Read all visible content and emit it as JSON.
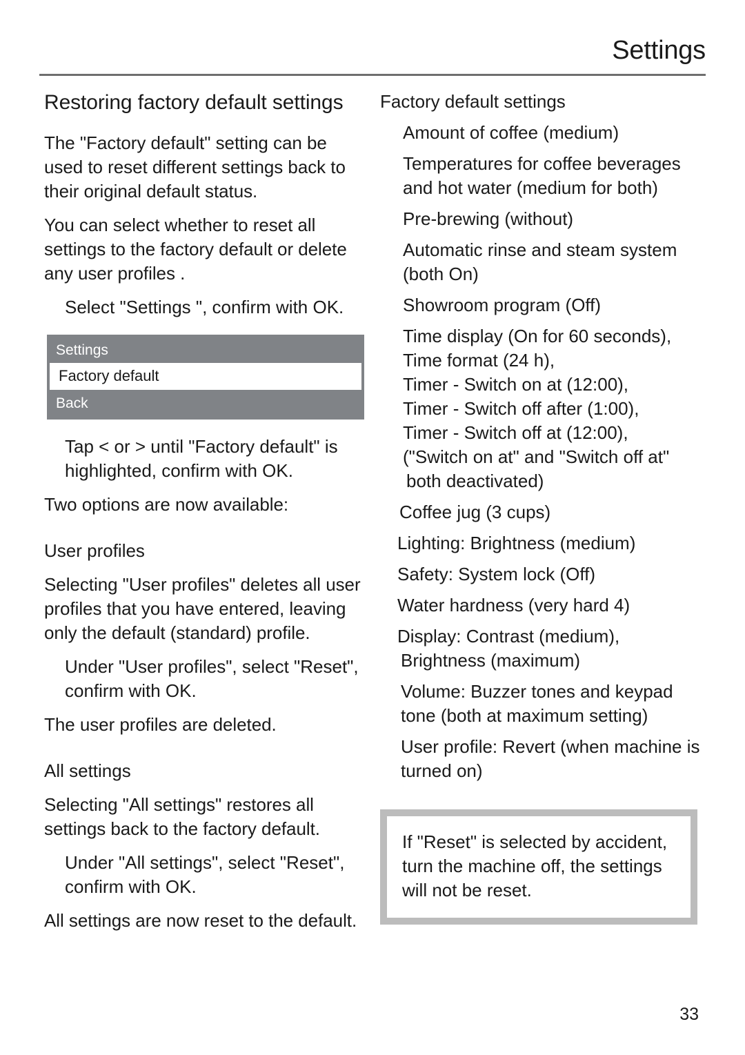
{
  "header": {
    "title": "Settings"
  },
  "left_column": {
    "section_title": "Restoring factory default settings",
    "intro_paragraph_1": "The \"Factory default\" setting can be used to reset different settings back to their original default status.",
    "intro_paragraph_2": "You can select whether to reset all settings  to the factory default or delete any user profiles  .",
    "step_select_settings": "Select \"Settings   \", confirm with OK.",
    "display": {
      "title": "Settings",
      "selected_item": "Factory  default",
      "back_item": "Back"
    },
    "step_tap": "Tap < or > until \"Factory default\" is highlighted, confirm with OK.",
    "two_options_line": "Two options are now available:",
    "user_profiles": {
      "heading": "User profiles",
      "body": "Selecting \"User profiles\" deletes all user profiles that you have entered, leaving only the default (standard) profile.",
      "step": "Under \"User profiles\", select \"Reset\", confirm with OK.",
      "result": "The user profiles are deleted."
    },
    "all_settings": {
      "heading": "All settings",
      "body": "Selecting \"All settings\" restores all settings back to the factory default.",
      "step": "Under \"All settings\", select \"Reset\", confirm with OK.",
      "result": "All settings are now reset to the default."
    }
  },
  "right_column": {
    "list_heading": "Factory default settings",
    "items": [
      "Amount of coffee (medium)",
      "Temperatures for coffee beverages and hot water (medium for both)",
      "Pre-brewing (without)",
      "Automatic rinse and steam system (both On)",
      "Showroom program (Off)",
      "Time display (On for 60 seconds), Time format (24 h), Timer - Switch on at (12:00), Timer - Switch off after (1:00), Timer - Switch off at (12:00), (\"Switch on at\" and \"Switch off at\" both deactivated)",
      "Coffee jug (3 cups)",
      "Lighting: Brightness (medium)",
      "Safety: System lock (Off)",
      "Water hardness (very hard 4)",
      "Display: Contrast (medium), Brightness (maximum)",
      "Volume:  Buzzer tones and keypad tone (both at maximum setting)",
      "User profile: Revert (when machine is turned on)"
    ],
    "item_lines": {
      "amount_of_coffee": [
        "Amount of coffee (medium)"
      ],
      "temperatures": [
        "Temperatures for coffee beverages",
        "and hot water (medium for both)"
      ],
      "pre_brewing": [
        "Pre-brewing (without)"
      ],
      "automatic_rinse": [
        "Automatic rinse and steam system",
        "(both On)"
      ],
      "showroom": [
        "Showroom program (Off)"
      ],
      "time_block": [
        "Time display (On for 60 seconds),",
        "Time format (24 h),",
        "Timer - Switch on at (12:00),",
        "Timer - Switch off after (1:00),",
        "Timer - Switch off at (12:00),",
        "(\"Switch on at\" and \"Switch off at\"",
        "both deactivated)"
      ],
      "coffee_jug": [
        "Coffee jug (3 cups)"
      ],
      "lighting": [
        "Lighting: Brightness (medium)"
      ],
      "safety": [
        "Safety: System lock (Off)"
      ],
      "water_hardness": [
        "Water hardness (very hard 4)"
      ],
      "display": [
        "Display: Contrast (medium),",
        "Brightness (maximum)"
      ],
      "volume": [
        "Volume:  Buzzer tones and keypad",
        "tone (both at maximum setting)"
      ],
      "user_profile": [
        "User profile: Revert (when machine is",
        "turned on)"
      ]
    },
    "note": "If \"Reset\" is selected by accident, turn the machine off, the settings will not be reset."
  },
  "footer": {
    "page_number": "33"
  },
  "colors": {
    "display_background": "#808387",
    "display_selected_background": "#ffffff",
    "note_border": "#bcbcbc",
    "rule": "#6e6e6e",
    "text": "#1a1a1a"
  }
}
